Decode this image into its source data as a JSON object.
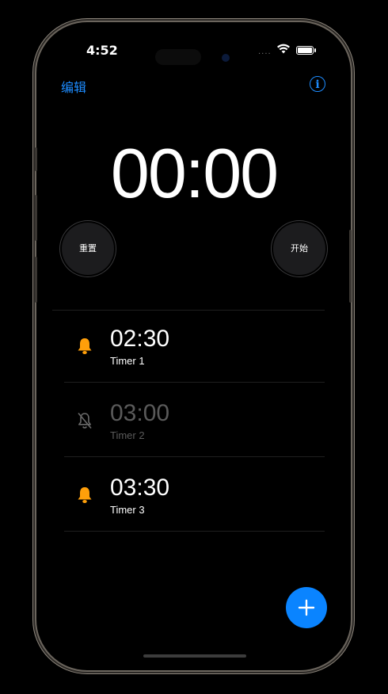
{
  "status": {
    "time": "4:52",
    "signal": "....",
    "wifi_icon": "wifi-icon",
    "battery_icon": "battery-icon"
  },
  "nav": {
    "edit_label": "编辑",
    "info_icon": "i"
  },
  "timer": {
    "display": "00:00"
  },
  "controls": {
    "reset_label": "重置",
    "start_label": "开始"
  },
  "timers": [
    {
      "time": "02:30",
      "label": "Timer 1",
      "enabled": true,
      "icon": "bell-icon"
    },
    {
      "time": "03:00",
      "label": "Timer 2",
      "enabled": false,
      "icon": "bell-slash-icon"
    },
    {
      "time": "03:30",
      "label": "Timer 3",
      "enabled": true,
      "icon": "bell-icon"
    }
  ],
  "colors": {
    "accent": "#0a84ff",
    "link": "#1d8cff",
    "bell": "#ff9f0a",
    "disabled": "#5a5a5a"
  },
  "fab": {
    "icon": "plus-icon"
  }
}
